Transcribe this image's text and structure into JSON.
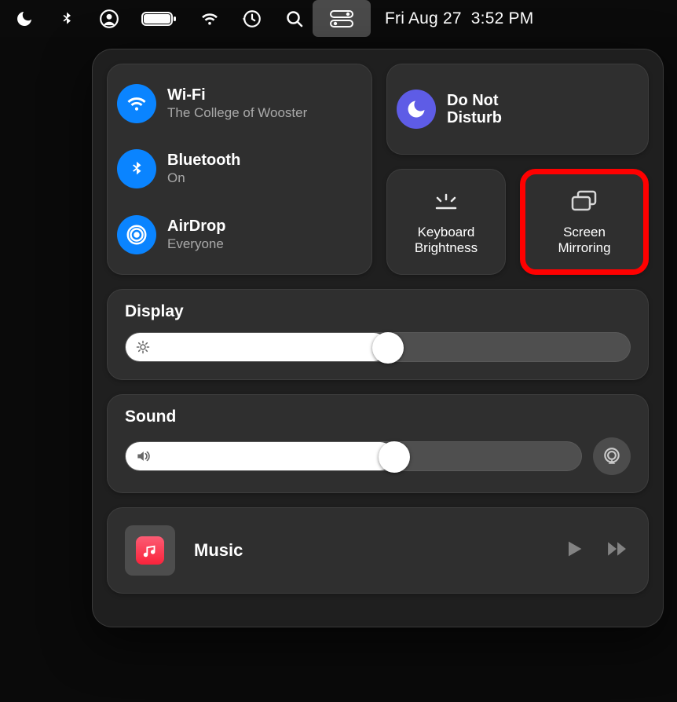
{
  "menubar": {
    "clock": "Fri Aug 27  3:52 PM"
  },
  "connectivity": {
    "wifi": {
      "label": "Wi-Fi",
      "sub": "The College of Wooster"
    },
    "bluetooth": {
      "label": "Bluetooth",
      "sub": "On"
    },
    "airdrop": {
      "label": "AirDrop",
      "sub": "Everyone"
    }
  },
  "dnd": {
    "line1": "Do Not",
    "line2": "Disturb"
  },
  "tiles": {
    "keyboard": {
      "line1": "Keyboard",
      "line2": "Brightness"
    },
    "mirroring": {
      "line1": "Screen",
      "line2": "Mirroring"
    }
  },
  "display": {
    "title": "Display",
    "value": 52
  },
  "sound": {
    "title": "Sound",
    "value": 59
  },
  "music": {
    "title": "Music"
  }
}
